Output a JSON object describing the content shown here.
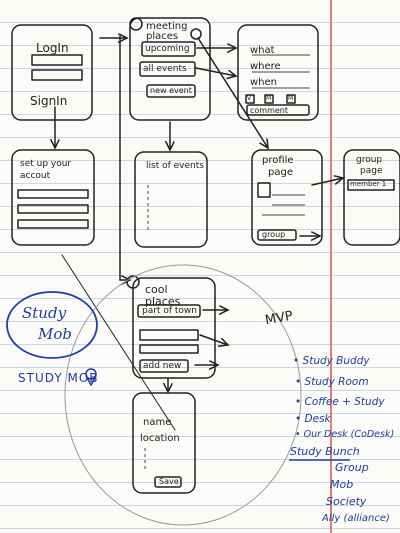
{
  "screens": {
    "login": {
      "title": "LogIn",
      "signup": "SignIn"
    },
    "setup": {
      "line1": "set up your",
      "line2": "accout"
    },
    "meeting": {
      "title1": "meeting",
      "title2": "places",
      "upcoming": "upcoming",
      "all_events": "all events",
      "new_event": "new event"
    },
    "event_form": {
      "what": "what",
      "where": "where",
      "when": "when",
      "icons": [
        "V",
        "M",
        "M"
      ],
      "comment": "comment"
    },
    "events_list": {
      "title": "list of events"
    },
    "profile": {
      "title1": "profile",
      "title2": "page",
      "group": "group"
    },
    "group_page": {
      "title1": "group",
      "title2": "page",
      "member": "member 1"
    },
    "cool_places": {
      "title1": "cool",
      "title2": "places",
      "part_of_town": "part of town",
      "add_new": "add new"
    },
    "add_place": {
      "name": "name",
      "location": "location",
      "save": "Save"
    }
  },
  "labels": {
    "mvp": "MVP"
  },
  "logo": {
    "line1": "Study",
    "line2": "Mob",
    "wordmark": "STUDY MOB"
  },
  "name_ideas": {
    "bullets": [
      "Study Buddy",
      "Study Room",
      "Coffee + Study",
      "Desk",
      "Our Desk (CoDesk)"
    ],
    "list_heading": "Study Bunch",
    "options": [
      "Group",
      "Mob",
      "Society",
      "Ally (alliance)"
    ]
  }
}
